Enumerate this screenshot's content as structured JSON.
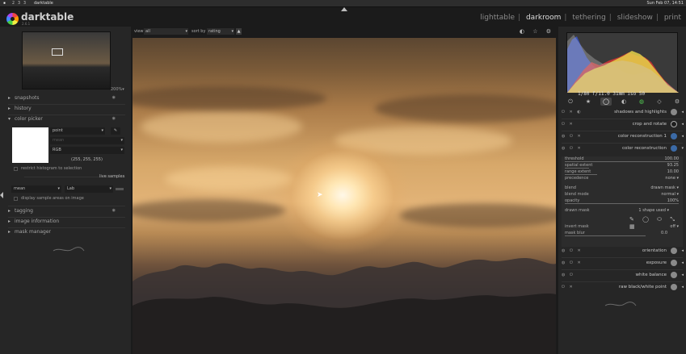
{
  "os": {
    "workspaces": [
      "2",
      "3",
      "3"
    ],
    "window_title": "darktable",
    "clock": "Sun Feb 07, 14:51"
  },
  "app": {
    "name": "darktable",
    "version": "2.6.1",
    "views": [
      "lighttable",
      "darkroom",
      "tethering",
      "slideshow",
      "print"
    ],
    "view_separator": "|",
    "active_view": "darkroom"
  },
  "navigation": {
    "zoom": "200%▾"
  },
  "left_panel": {
    "snapshots": "snapshots",
    "history": "history",
    "color_picker": {
      "title": "color picker",
      "mode": "point",
      "blank_combo": "mean",
      "model": "RGB",
      "values": "(255, 255, 255)",
      "restrict": "restrict histogram to selection",
      "live_samples": "live samples",
      "stat": "mean",
      "space": "Lab",
      "display_samples": "display sample areas on image"
    },
    "tagging": "tagging",
    "image_information": "image information",
    "mask_manager": "mask manager"
  },
  "center_bar": {
    "view_label": "view",
    "view_value": "all",
    "sort_label": "sort by",
    "sort_value": "rating",
    "sort_dir": "▲",
    "icons": "◐ ☆ ⚙"
  },
  "right_panel": {
    "histogram_info": "1/80 f/11.0 31mm iso 50",
    "group_icons": [
      "⏻",
      "★",
      "◯",
      "◐",
      "◍",
      "◇",
      "⚙"
    ],
    "modules_top": [
      {
        "name": "shadows and highlights",
        "arrow": "◂"
      },
      {
        "name": "crop and rotate",
        "arrow": "◂"
      },
      {
        "name": "color reconstruction 1",
        "arrow": "◂"
      },
      {
        "name": "color reconstruction",
        "arrow": "▾"
      }
    ],
    "expanded": {
      "threshold": {
        "label": "threshold",
        "value": "100.00"
      },
      "spatial_extent": {
        "label": "spatial extent",
        "value": "93.25"
      },
      "range_extent": {
        "label": "range extent",
        "value": "10.00"
      },
      "precedence": {
        "label": "precedence",
        "value": "none ▾"
      },
      "blend": {
        "label": "blend",
        "value": "drawn mask ▾"
      },
      "blend_mode": {
        "label": "blend mode",
        "value": "normal ▾"
      },
      "opacity": {
        "label": "opacity",
        "value": "100%"
      },
      "drawn_mask": {
        "label": "drawn mask",
        "value": "1 shape used ▾"
      },
      "invert_mask": {
        "label": "invert mask",
        "value": "off ▾"
      },
      "mask_blur": {
        "label": "mask blur",
        "value": "0.0"
      }
    },
    "modules_bottom": [
      {
        "name": "orientation",
        "arrow": "◂"
      },
      {
        "name": "exposure",
        "arrow": "◂"
      },
      {
        "name": "white balance",
        "arrow": "◂"
      },
      {
        "name": "raw black/white point",
        "arrow": "◂"
      }
    ]
  },
  "colors": {
    "panel": "#262626",
    "background": "#1b1b1b",
    "text": "#9a9a9a"
  }
}
